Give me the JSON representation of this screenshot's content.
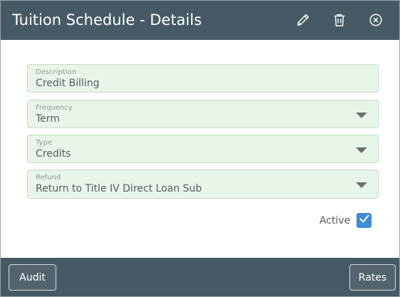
{
  "dialog": {
    "title": "Tuition Schedule - Details",
    "header_icons": [
      "pencil-icon",
      "trash-icon",
      "close-circle-icon"
    ],
    "colors": {
      "header_bg": "#455a64",
      "field_bg": "#e8f5e9",
      "checkbox_accent": "#3d8bd9"
    }
  },
  "form": {
    "description": {
      "label": "Description",
      "value": "Credit Billing"
    },
    "frequency": {
      "label": "Frequency",
      "value": "Term"
    },
    "type": {
      "label": "Type",
      "value": "Credits"
    },
    "refund": {
      "label": "Refund",
      "value": "Return to Title IV Direct Loan Sub"
    },
    "active": {
      "label": "Active",
      "checked": true
    }
  },
  "footer": {
    "audit_label": "Audit",
    "rates_label": "Rates"
  }
}
